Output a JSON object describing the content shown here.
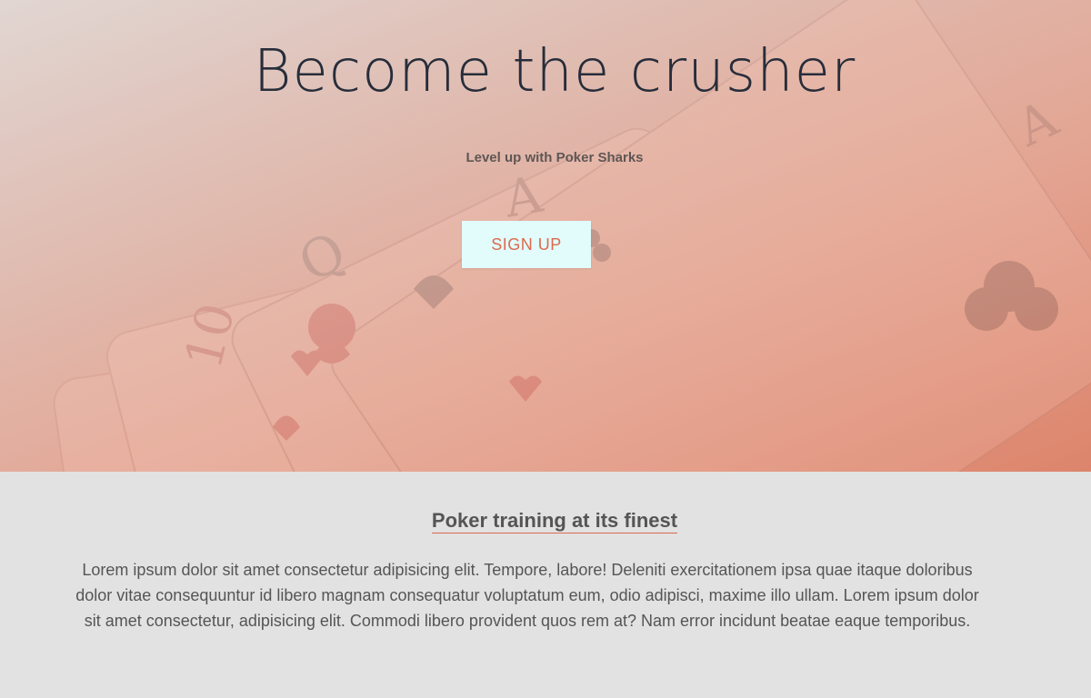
{
  "hero": {
    "title": "Become the crusher",
    "subtitle": "Level up with Poker Sharks",
    "cta_label": "SIGN UP"
  },
  "about": {
    "heading": "Poker training at its finest",
    "body": "Lorem ipsum dolor sit amet consectetur adipisicing elit. Tempore, labore! Deleniti exercitationem ipsa quae itaque doloribus dolor vitae consequuntur id libero magnam consequatur voluptatum eum, odio adipisci, maxime illo ullam. Lorem ipsum dolor sit amet consectetur, adipisicing elit. Commodi libero provident quos rem at? Nam error incidunt beatae eaque temporibus."
  },
  "colors": {
    "accent": "#dd6a4f",
    "button_bg": "#e2fbfb",
    "title_text": "#272d3a",
    "body_text": "#555555",
    "section_bg": "#e2e2e2"
  },
  "background_image": "playing-cards-image"
}
